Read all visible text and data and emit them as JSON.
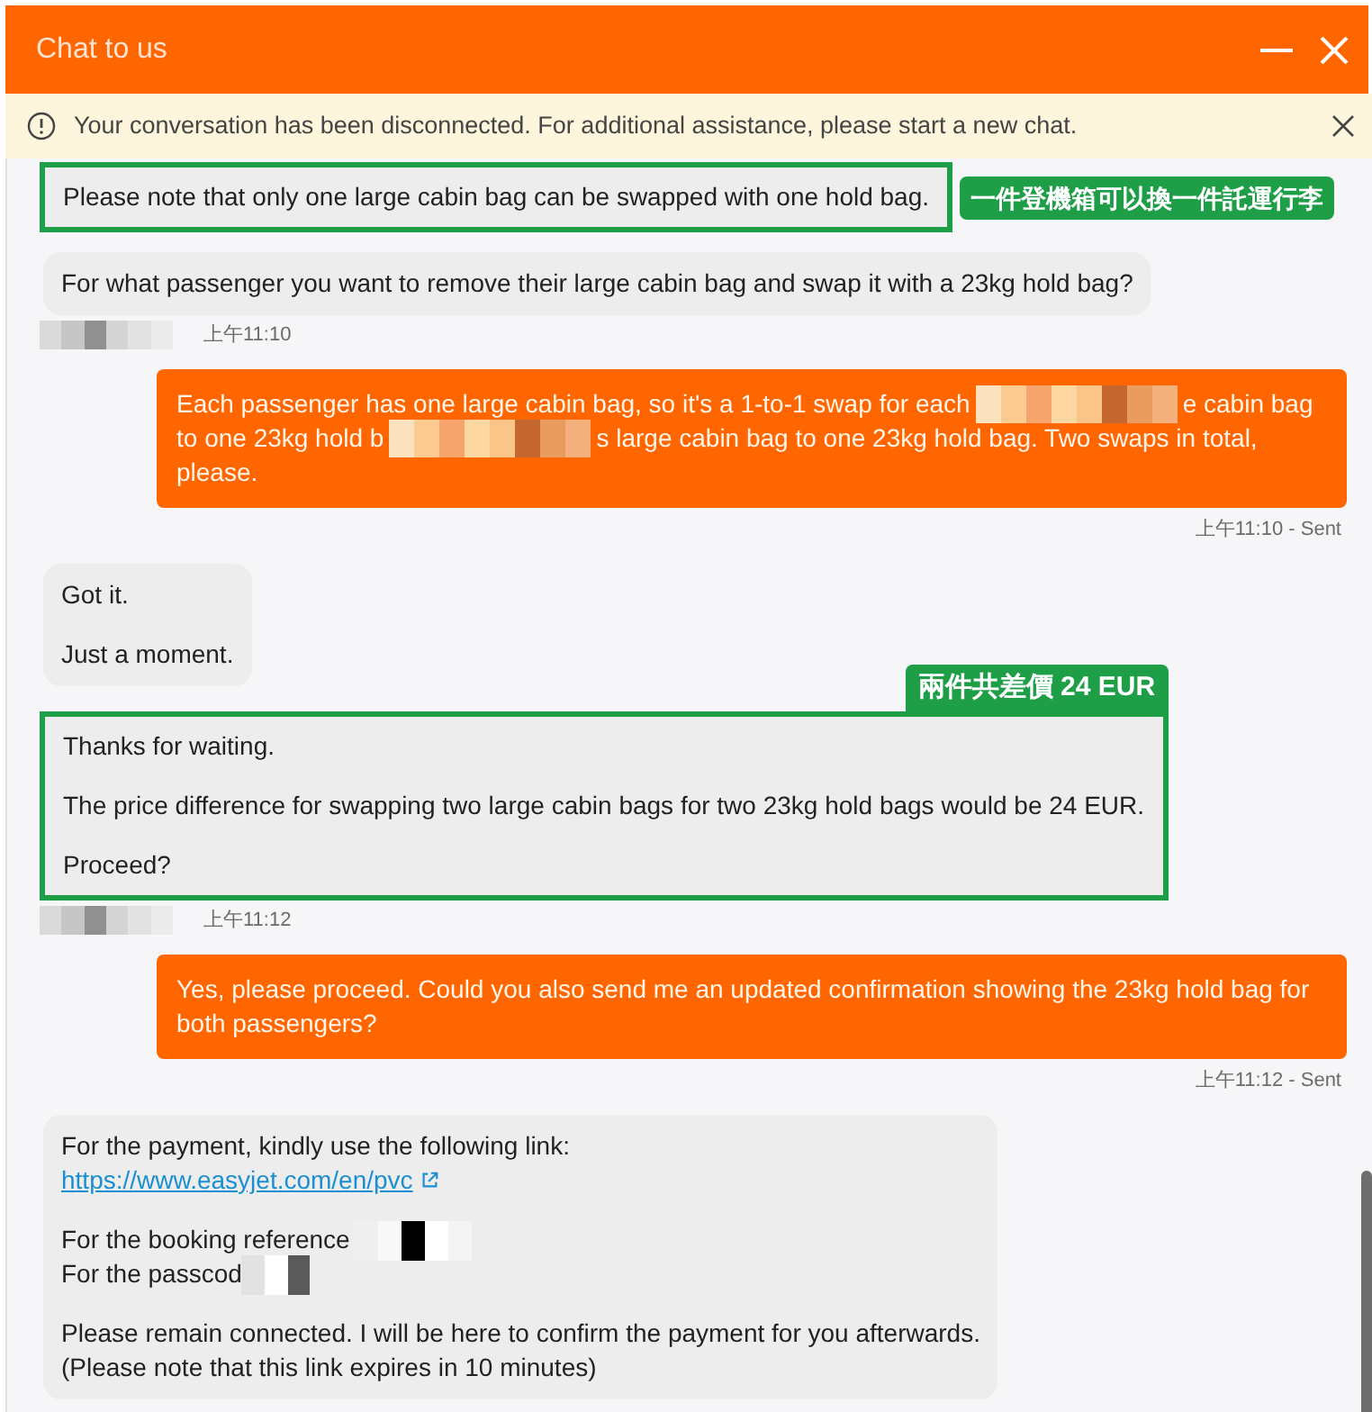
{
  "window": {
    "title": "Chat to us"
  },
  "banner": {
    "text": "Your conversation has been disconnected. For additional assistance, please start a new chat."
  },
  "messages": [
    {
      "kind": "agent",
      "paragraphs": [
        {
          "kind": "text",
          "text": "Please note that only one large cabin bag can be swapped with one hold bag."
        }
      ],
      "highlight": {
        "kind": "side",
        "label": "一件登機箱可以換一件託運行李"
      }
    },
    {
      "kind": "agent",
      "paragraphs": [
        {
          "kind": "text",
          "text": "For what passenger you want to remove their large cabin bag and swap it with a 23kg hold bag?"
        }
      ]
    },
    {
      "kind": "agent_stamp",
      "name": {
        "kind": "redacted_gray"
      },
      "time": "上午11:10"
    },
    {
      "kind": "user",
      "paragraphs": [
        {
          "kind": "lines",
          "lines": [
            [
              {
                "kind": "text",
                "text": "Each passenger has one large cabin bag, so it's a 1-to-1 swap for each"
              },
              {
                "kind": "redacted_warm"
              },
              {
                "kind": "text",
                "text": "e cabin bag"
              }
            ],
            [
              {
                "kind": "text",
                "text": "to one 23kg hold b"
              },
              {
                "kind": "redacted_warm"
              },
              {
                "kind": "text",
                "text": "s large cabin bag to one 23kg hold bag. Two swaps in total,"
              }
            ],
            [
              {
                "kind": "text",
                "text": "please."
              }
            ]
          ]
        }
      ]
    },
    {
      "kind": "user_stamp",
      "time": "上午11:10 - Sent"
    },
    {
      "kind": "agent",
      "paragraphs": [
        {
          "kind": "text",
          "text": "Got it."
        },
        {
          "kind": "text",
          "text": "Just a moment."
        }
      ]
    },
    {
      "kind": "agent",
      "paragraphs": [
        {
          "kind": "text",
          "text": "Thanks for waiting."
        },
        {
          "kind": "text",
          "text": "The price difference for swapping two large cabin bags for two 23kg hold bags would be 24 EUR."
        },
        {
          "kind": "text",
          "text": "Proceed?"
        }
      ],
      "highlight": {
        "kind": "top",
        "label": "兩件共差價 24 EUR"
      }
    },
    {
      "kind": "agent_stamp",
      "name": {
        "kind": "redacted_gray"
      },
      "time": "上午11:12"
    },
    {
      "kind": "user",
      "paragraphs": [
        {
          "kind": "text",
          "text": "Yes, please proceed. Could you also send me an updated confirmation showing the 23kg hold bag for both passengers?"
        }
      ]
    },
    {
      "kind": "user_stamp",
      "time": "上午11:12 - Sent"
    },
    {
      "kind": "agent",
      "paragraphs": [
        {
          "kind": "lines",
          "lines": [
            [
              {
                "kind": "text",
                "text": "For the payment, kindly use the following link:"
              }
            ],
            [
              {
                "kind": "link",
                "text": "https://www.easyjet.com/en/pvc"
              }
            ]
          ]
        },
        {
          "kind": "lines",
          "lines": [
            [
              {
                "kind": "text",
                "text": "For the booking reference"
              },
              {
                "kind": "redacted_dark"
              }
            ],
            [
              {
                "kind": "text",
                "text": "For the passcod"
              },
              {
                "kind": "redacted_mid"
              }
            ]
          ]
        },
        {
          "kind": "lines",
          "lines": [
            [
              {
                "kind": "text",
                "text": "Please remain connected. I will be here to confirm the payment for you afterwards."
              }
            ],
            [
              {
                "kind": "text",
                "text": "(Please note that this link expires in 10 minutes)"
              }
            ]
          ]
        }
      ]
    }
  ]
}
